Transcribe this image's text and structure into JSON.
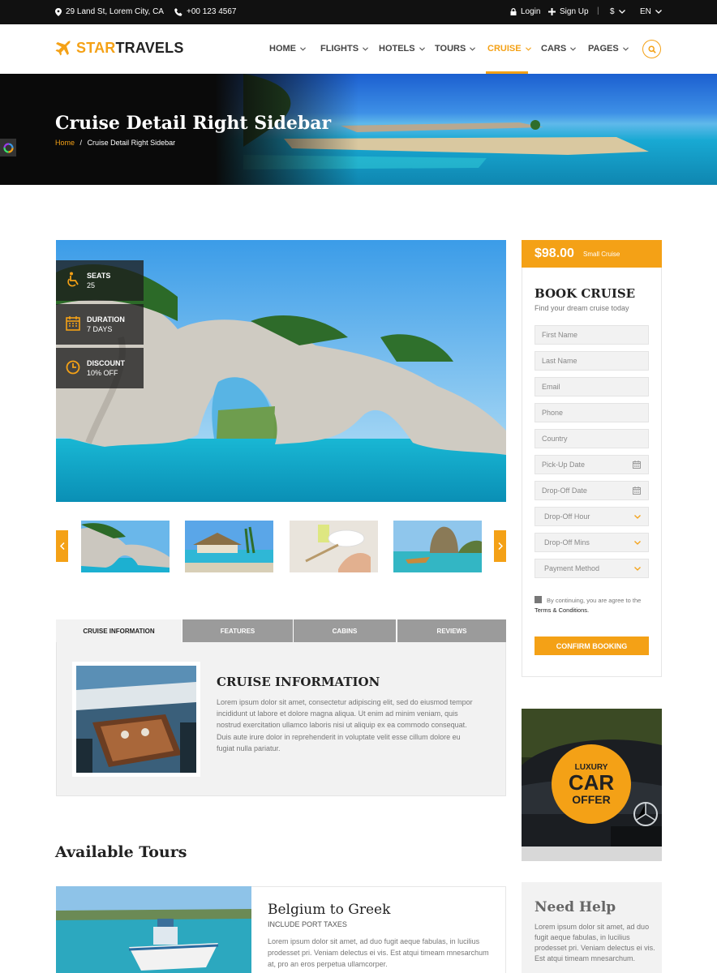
{
  "topbar": {
    "address": "29 Land St, Lorem City, CA",
    "phone": "+00 123 4567",
    "login": "Login",
    "signup": "Sign Up",
    "currency": "$",
    "language": "EN"
  },
  "header": {
    "logo_part1": "STAR",
    "logo_part2": "TRAVELS",
    "nav": [
      "HOME",
      "FLIGHTS",
      "HOTELS",
      "TOURS",
      "CRUISE",
      "CARS",
      "PAGES"
    ],
    "active_nav": "CRUISE"
  },
  "hero": {
    "title": "Cruise Detail Right Sidebar",
    "breadcrumb_home": "Home",
    "breadcrumb_sep": "/",
    "breadcrumb_current": "Cruise Detail Right Sidebar"
  },
  "stats": [
    {
      "label": "SEATS",
      "value": "25",
      "icon": "wheelchair-icon"
    },
    {
      "label": "DURATION",
      "value": "7 DAYS",
      "icon": "calendar-icon"
    },
    {
      "label": "DISCOUNT",
      "value": "10% OFF",
      "icon": "clock-icon"
    }
  ],
  "tabs": [
    "CRUISE INFORMATION",
    "FEATURES",
    "CABINS",
    "REVIEWS"
  ],
  "info": {
    "title": "CRUISE INFORMATION",
    "text": "Lorem ipsum dolor sit amet, consectetur adipiscing elit, sed do eiusmod tempor incididunt ut labore et dolore magna aliqua. Ut enim ad minim veniam, quis nostrud exercitation ullamco laboris nisi ut aliquip ex ea commodo consequat. Duis aute irure dolor in reprehenderit in voluptate velit esse cillum dolore eu fugiat nulla pariatur."
  },
  "available": {
    "title": "Available Tours",
    "tour_name": "Belgium to Greek",
    "tour_sub": "INCLUDE PORT TAXES",
    "tour_text": "Lorem ipsum dolor sit amet, ad duo fugit aeque fabulas, in lucilius prodesset pri. Veniam delectus ei vis. Est atqui timeam mnesarchum at, pro an eros perpetua ullamcorper."
  },
  "booking": {
    "price": "$98.00",
    "price_tag": "Small Cruise",
    "title": "BOOK CRUISE",
    "subtitle": "Find your dream cruise today",
    "fields": [
      "First Name",
      "Last Name",
      "Email",
      "Phone",
      "Country",
      "Pick-Up Date",
      "Drop-Off Date",
      "Drop-Off Hour",
      "Drop-Off Mins",
      "Payment Method"
    ],
    "agree_text": "By continuing, you are agree to the",
    "terms": "Terms & Conditions.",
    "confirm": "CONFIRM BOOKING"
  },
  "offer": {
    "line1": "LUXURY",
    "line2": "CAR",
    "line3": "OFFER"
  },
  "help": {
    "title": "Need Help",
    "text": "Lorem ipsum dolor sit amet, ad duo fugit aeque fabulas, in lucilius prodesset pri. Veniam delectus ei vis. Est atqui timeam mnesarchum."
  },
  "colors": {
    "accent": "#f4a116",
    "topbar": "#111111"
  }
}
